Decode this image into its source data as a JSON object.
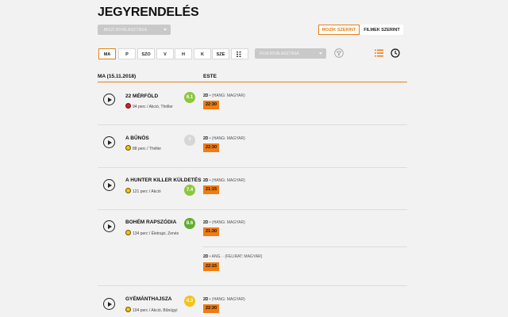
{
  "page_title": "JEGYRENDELÉS",
  "cinema_select": {
    "placeholder": "MOZI KIVÁLASZTÁSA"
  },
  "view_toggle": {
    "cinemas": "MOZIK SZERINT",
    "films": "FILMEK SZERINT",
    "active": "cinemas"
  },
  "days": [
    "MA",
    "P",
    "SZO",
    "V",
    "H",
    "K",
    "SZE"
  ],
  "film_select": {
    "placeholder": "FILM KIVÁLASZTÁSA"
  },
  "schedule_header": {
    "date": "MA (15.11.2018)",
    "period": "ESTE"
  },
  "films": [
    {
      "title": "22 MÉRFÖLD",
      "age_rating_color": "red",
      "duration": "94 perc",
      "genres": "Akció, Thriller",
      "score": "6.1",
      "score_color": "#8cc63f",
      "shows": [
        {
          "format": "2D",
          "language": "HANG: MAGYAR",
          "times": [
            "22:30"
          ]
        }
      ]
    },
    {
      "title": "A BŰNÖS",
      "age_rating_color": "yellow",
      "duration": "88 perc",
      "genres": "Thriller",
      "score": "?",
      "score_color": "#d6d6d6",
      "shows": [
        {
          "format": "2D",
          "language": "HANG: MAGYAR",
          "times": [
            "22:30"
          ]
        }
      ]
    },
    {
      "title": "A HUNTER KILLER KÜLDETÉS",
      "age_rating_color": "yellow",
      "duration": "121 perc",
      "genres": "Akció",
      "score": "7.4",
      "score_color": "#8cc63f",
      "shows": [
        {
          "format": "2D",
          "language": "HANG: MAGYAR",
          "times": [
            "21:15"
          ]
        }
      ]
    },
    {
      "title": "BOHÉM RAPSZÓDIA",
      "age_rating_color": "yellow",
      "duration": "134 perc",
      "genres": "Életrajzi, Zenés",
      "score": "8.6",
      "score_color": "#5fae2e",
      "shows": [
        {
          "format": "2D",
          "language": "HANG: MAGYAR",
          "times": [
            "21:30"
          ]
        },
        {
          "format": "2D",
          "language": "ANG. · (FELIRAT: MAGYAR)",
          "times": [
            "22:15"
          ]
        }
      ]
    },
    {
      "title": "GYÉMÁNTHAJSZA",
      "age_rating_color": "yellow",
      "duration": "104 perc",
      "genres": "Akció, Bűnügyi",
      "score": "4.3",
      "score_color": "#f3c315",
      "shows": [
        {
          "format": "2D",
          "language": "HANG: MAGYAR",
          "times": [
            "22:30"
          ]
        }
      ]
    }
  ],
  "colors": {
    "accent": "#e8801a",
    "showtime_bg": "#f07c12"
  },
  "icons": [
    "filter-icon",
    "list-view-icon",
    "clock-icon",
    "grid-icon",
    "play-icon"
  ]
}
